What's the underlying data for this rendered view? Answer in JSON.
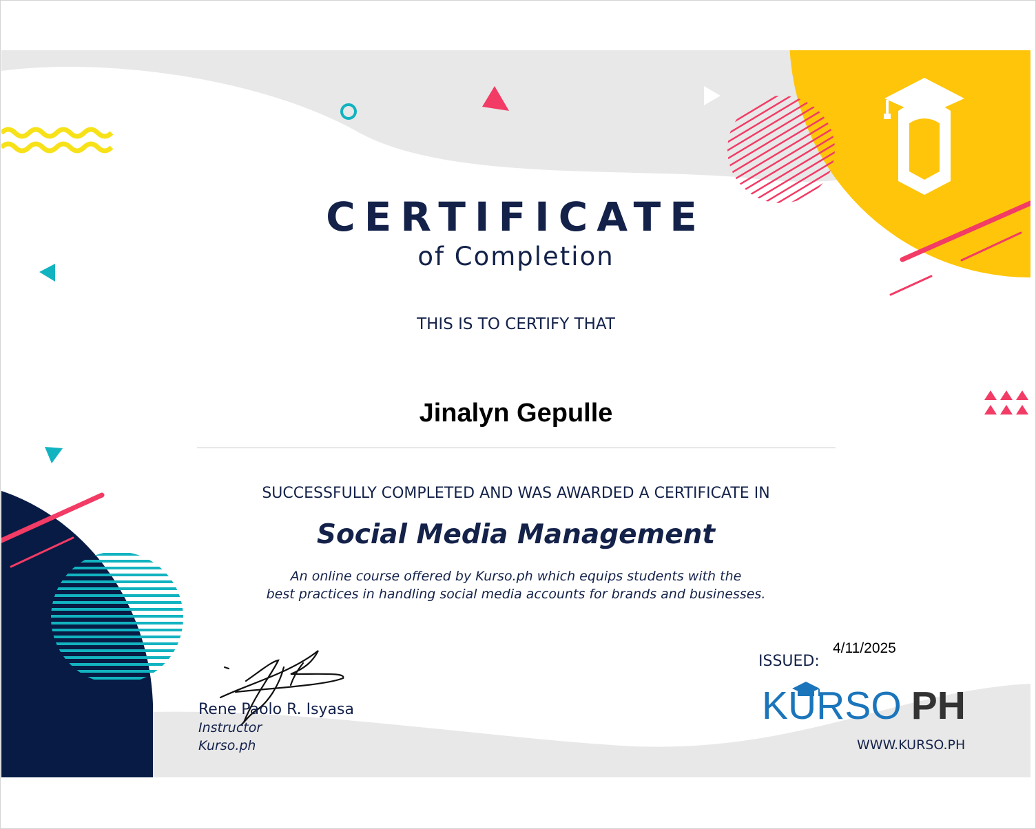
{
  "certificate": {
    "title": "CERTIFICATE",
    "subtitle": "of Completion",
    "certify_line": "THIS IS TO CERTIFY THAT",
    "recipient_name": "Jinalyn Gepulle",
    "awarded_line": "SUCCESSFULLY COMPLETED AND WAS AWARDED A CERTIFICATE IN",
    "course_title": "Social Media Management",
    "description_line_1": "An online course offered by Kurso.ph which equips students with the",
    "description_line_2": "best practices in handling social media accounts for brands and businesses."
  },
  "signatory": {
    "name": "Rene Paolo R. Isyasa",
    "role": "Instructor",
    "organization": "Kurso.ph"
  },
  "issue": {
    "label": "ISSUED:",
    "date": "4/11/2025"
  },
  "brand": {
    "wordmark_primary": "KURSO",
    "wordmark_secondary": "PH",
    "website": "WWW.KURSO.PH"
  },
  "icons": {
    "top_right_emblem": "graduation-cap-icon",
    "logo_cap": "graduation-cap-icon",
    "signature": "signature-mark"
  },
  "colors": {
    "navy": "#14224a",
    "yellow": "#ffc50a",
    "pink": "#f23b65",
    "teal": "#12b3c0",
    "brand_blue": "#1b75bb",
    "wave_gray": "#e8e8e8",
    "dark_navy": "#071b44"
  }
}
